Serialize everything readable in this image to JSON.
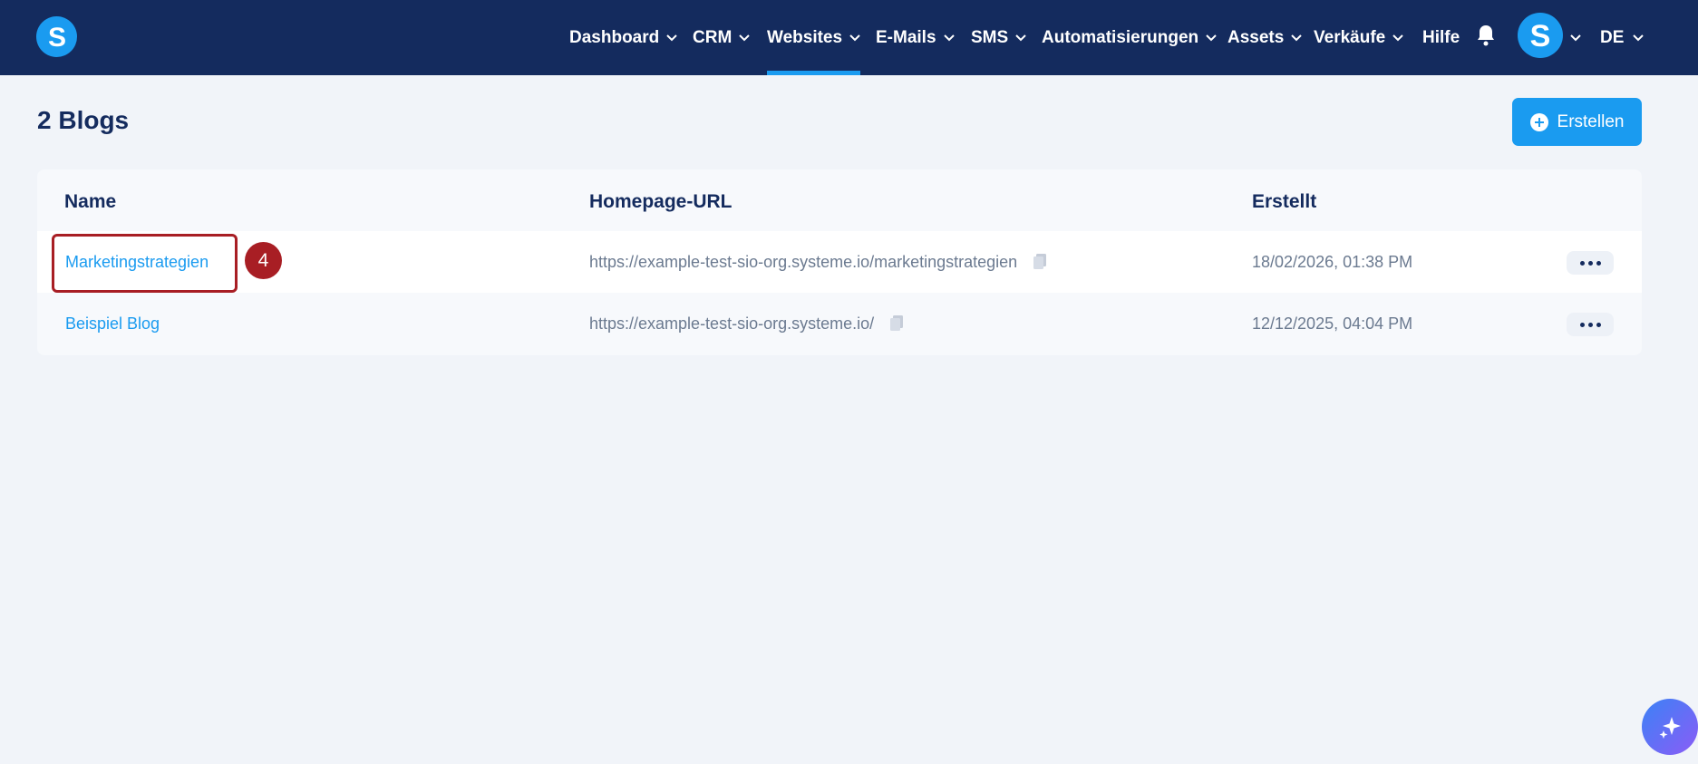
{
  "nav": {
    "items": [
      {
        "label": "Dashboard"
      },
      {
        "label": "CRM"
      },
      {
        "label": "Websites"
      },
      {
        "label": "E-Mails"
      },
      {
        "label": "SMS"
      },
      {
        "label": "Automatisierungen"
      },
      {
        "label": "Assets"
      },
      {
        "label": "Verkäufe"
      }
    ],
    "help_label": "Hilfe",
    "language": "DE",
    "active": "Websites"
  },
  "page": {
    "title": "2 Blogs",
    "create_label": "Erstellen"
  },
  "table": {
    "columns": [
      "Name",
      "Homepage-URL",
      "Erstellt"
    ],
    "rows": [
      {
        "name": "Marketingstrategien",
        "url": "https://example-test-sio-org.systeme.io/marketingstrategien",
        "created": "18/02/2026, 01:38 PM"
      },
      {
        "name": "Beispiel Blog",
        "url": "https://example-test-sio-org.systeme.io/",
        "created": "12/12/2025, 04:04 PM"
      }
    ]
  },
  "annotation": {
    "step": "4"
  },
  "colors": {
    "nav_bg": "#142b5e",
    "accent": "#1a9bf0",
    "annotation": "#a81e24",
    "page_bg": "#f1f4f9"
  },
  "icons": [
    "logo-icon",
    "chevron-down-icon",
    "bell-icon",
    "avatar-icon",
    "plus-circle-icon",
    "copy-icon",
    "more-icon",
    "ai-sparkle-icon"
  ]
}
